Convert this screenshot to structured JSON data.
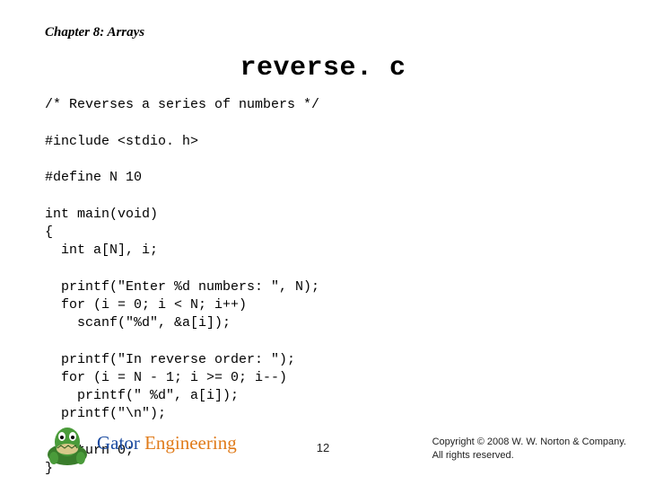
{
  "header": {
    "chapter": "Chapter 8: Arrays"
  },
  "title": "reverse. c",
  "code": "/* Reverses a series of numbers */\n\n#include <stdio. h>\n\n#define N 10\n\nint main(void)\n{\n  int a[N], i;\n\n  printf(\"Enter %d numbers: \", N);\n  for (i = 0; i < N; i++)\n    scanf(\"%d\", &a[i]);\n\n  printf(\"In reverse order: \");\n  for (i = N - 1; i >= 0; i--)\n    printf(\" %d\", a[i]);\n  printf(\"\\n\");\n\n  return 0;\n}",
  "footer": {
    "brand_first": "Gator ",
    "brand_second": "Engineering",
    "page": "12",
    "copyright_line1": "Copyright © 2008 W. W. Norton & Company.",
    "copyright_line2": "All rights reserved."
  }
}
